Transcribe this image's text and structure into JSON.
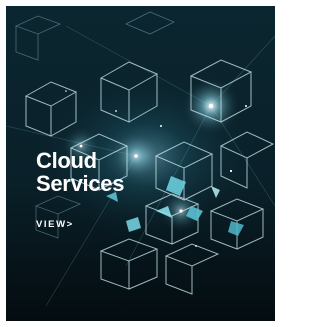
{
  "card": {
    "title_line1": "Cloud",
    "title_line2": "Services",
    "link_label": "VIEW>",
    "background_image": "network-cubes-illustration"
  },
  "colors": {
    "background": "#071820",
    "accent_cyan": "#6fd6e6",
    "text": "#ffffff"
  }
}
